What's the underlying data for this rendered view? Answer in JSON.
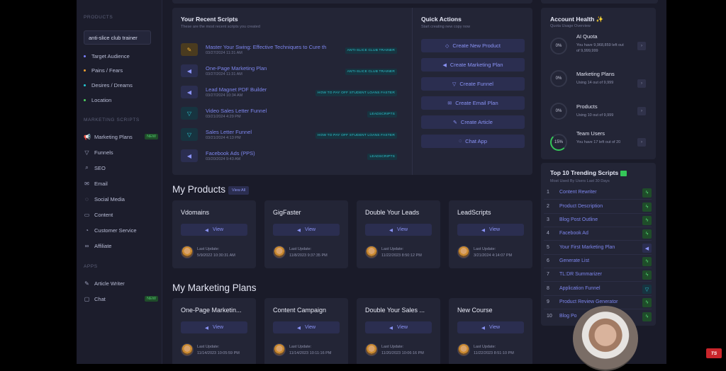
{
  "sidebar": {
    "products_label": "PRODUCTS",
    "product_value": "anti-slice club trainer",
    "product_items": [
      {
        "label": "Target Audience",
        "color": "#7b80ff"
      },
      {
        "label": "Pains / Fears",
        "color": "#f0a030"
      },
      {
        "label": "Desires / Dreams",
        "color": "#24c6d0"
      },
      {
        "label": "Location",
        "color": "#4fd05f"
      }
    ],
    "marketing_label": "MARKETING SCRIPTS",
    "marketing_items": [
      {
        "label": "Marketing Plans",
        "icon": "megaphone-icon",
        "badge": "NEW"
      },
      {
        "label": "Funnels",
        "icon": "funnel-icon"
      },
      {
        "label": "SEO",
        "icon": "magnifier-icon"
      },
      {
        "label": "Email",
        "icon": "envelope-icon"
      },
      {
        "label": "Social Media",
        "icon": "chat-icon"
      },
      {
        "label": "Content",
        "icon": "document-icon"
      },
      {
        "label": "Customer Service",
        "icon": "headset-icon"
      },
      {
        "label": "Affiliate",
        "icon": "link-icon"
      }
    ],
    "apps_label": "APPS",
    "apps_items": [
      {
        "label": "Article Writer",
        "icon": "pencil-icon"
      },
      {
        "label": "Chat",
        "icon": "chat-bubble-icon",
        "badge": "NEW"
      }
    ]
  },
  "recent": {
    "title": "Your Recent Scripts",
    "subtitle": "These are the most recent scripts you created",
    "rows": [
      {
        "title": "Master Your Swing: Effective Techniques to Cure th",
        "date": "03/27/2024 11:31 AM",
        "tag": "ANTI-SLICE CLUB TRAINER",
        "icon": "pencil-icon"
      },
      {
        "title": "One-Page Marketing Plan",
        "date": "03/27/2024 11:31 AM",
        "tag": "ANTI-SLICE CLUB TRAINER",
        "icon": "megaphone-icon"
      },
      {
        "title": "Lead Magnet PDF Builder",
        "date": "03/27/2024 10:34 AM",
        "tag": "HOW TO PAY OFF STUDENT LOANS FASTER",
        "icon": "megaphone-icon"
      },
      {
        "title": "Video Sales Letter Funnel",
        "date": "03/21/2024 4:29 PM",
        "tag": "LEADSCRIPTS",
        "icon": "funnel-icon"
      },
      {
        "title": "Sales Letter Funnel",
        "date": "03/21/2024 4:13 PM",
        "tag": "HOW TO PAY OFF STUDENT LOANS FASTER",
        "icon": "funnel-icon"
      },
      {
        "title": "Facebook Ads (PPS)",
        "date": "03/20/2024 9:43 AM",
        "tag": "LEADSCRIPTS",
        "icon": "megaphone-icon"
      }
    ]
  },
  "quick": {
    "title": "Quick Actions",
    "subtitle": "Start creating new copy now",
    "buttons": [
      {
        "label": "Create New Product",
        "icon": "tag-icon"
      },
      {
        "label": "Create Marketing Plan",
        "icon": "megaphone-icon"
      },
      {
        "label": "Create Funnel",
        "icon": "funnel-icon"
      },
      {
        "label": "Create Email Plan",
        "icon": "envelope-icon"
      },
      {
        "label": "Create Article",
        "icon": "pencil-icon"
      },
      {
        "label": "Chat App",
        "icon": "chat-icon"
      }
    ]
  },
  "products": {
    "title": "My Products",
    "view_all": "View All",
    "cards": [
      {
        "title": "Vdomains",
        "view": "View",
        "update_label": "Last Update:",
        "date": "5/9/2022 10:30:31 AM"
      },
      {
        "title": "GigFaster",
        "view": "View",
        "update_label": "Last Update:",
        "date": "11/8/2023 9:37:35 PM"
      },
      {
        "title": "Double Your Leads",
        "view": "View",
        "update_label": "Last Update:",
        "date": "11/22/2023 8:50:12 PM"
      },
      {
        "title": "LeadScripts",
        "view": "View",
        "update_label": "Last Update:",
        "date": "3/21/2024 4:14:07 PM"
      }
    ]
  },
  "plans": {
    "title": "My Marketing Plans",
    "cards": [
      {
        "title": "One-Page Marketin...",
        "view": "View",
        "update_label": "Last Update:",
        "date": "11/14/2023 10:05:59 PM"
      },
      {
        "title": "Content Campaign",
        "view": "View",
        "update_label": "Last Update:",
        "date": "11/14/2023 10:11:16 PM"
      },
      {
        "title": "Double Your Sales ...",
        "view": "View",
        "update_label": "Last Update:",
        "date": "11/20/2023 10:06:16 PM"
      },
      {
        "title": "New Course",
        "view": "View",
        "update_label": "Last Update:",
        "date": "11/22/2023 8:51:10 PM"
      }
    ]
  },
  "health": {
    "title": "Account Health ✨",
    "subtitle": "Quota Usage Overview",
    "items": [
      {
        "name": "AI Quota",
        "percent": "0%",
        "desc": "You have 9,968,859 left out of 9,999,999",
        "fraction": 0.0
      },
      {
        "name": "Marketing Plans",
        "percent": "0%",
        "desc": "Using 14 out of 9,999",
        "fraction": 0.0
      },
      {
        "name": "Products",
        "percent": "0%",
        "desc": "Using 10 out of 9,999",
        "fraction": 0.0
      },
      {
        "name": "Team Users",
        "percent": "15%",
        "desc": "You have 17 left out of 20",
        "fraction": 0.15
      }
    ]
  },
  "trending": {
    "title": "Top 10 Trending Scripts",
    "subtitle": "Most Used By Users Last 30 Days",
    "rows": [
      {
        "num": "1",
        "name": "Content Rewriter",
        "icon": "bolt-icon",
        "kind": "g"
      },
      {
        "num": "2",
        "name": "Product Description",
        "icon": "bolt-icon",
        "kind": "g"
      },
      {
        "num": "3",
        "name": "Blog Post Outline",
        "icon": "bolt-icon",
        "kind": "g"
      },
      {
        "num": "4",
        "name": "Facebook Ad",
        "icon": "bolt-icon",
        "kind": "g"
      },
      {
        "num": "5",
        "name": "Your First Marketing Plan",
        "icon": "megaphone-icon",
        "kind": "b"
      },
      {
        "num": "6",
        "name": "Generate List",
        "icon": "bolt-icon",
        "kind": "g"
      },
      {
        "num": "7",
        "name": "TL:DR Summarizer",
        "icon": "bolt-icon",
        "kind": "g"
      },
      {
        "num": "8",
        "name": "Application Funnel",
        "icon": "funnel-icon",
        "kind": "c"
      },
      {
        "num": "9",
        "name": "Product Review Generator",
        "icon": "bolt-icon",
        "kind": "g"
      },
      {
        "num": "10",
        "name": "Blog Po",
        "icon": "bolt-icon",
        "kind": "g"
      }
    ]
  },
  "overlay": {
    "logo_text": "TS"
  }
}
